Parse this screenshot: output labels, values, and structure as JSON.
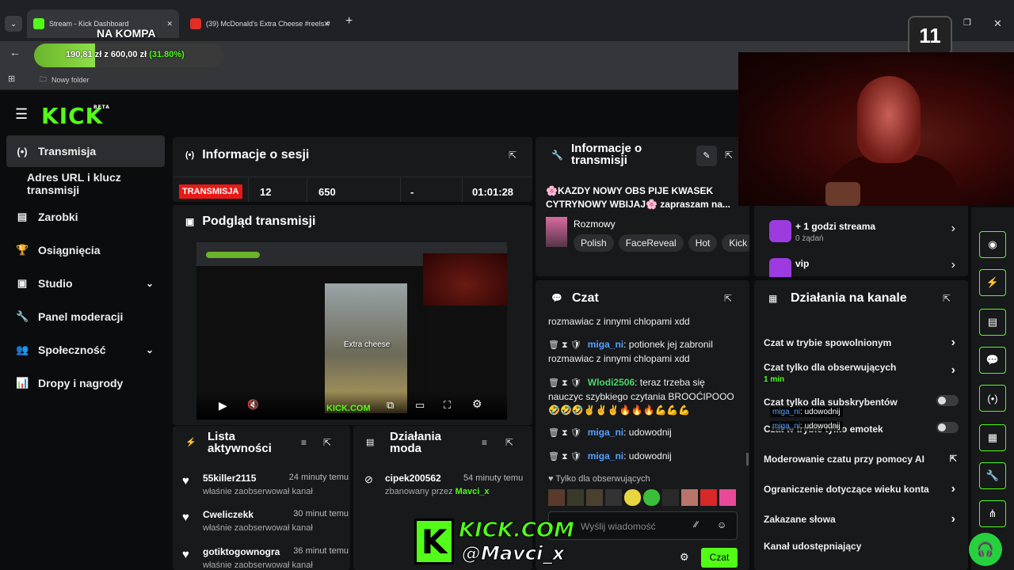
{
  "browser": {
    "tabs": [
      {
        "label": "Stream - Kick Dashboard",
        "active": true
      },
      {
        "label": "(39) McDonald's Extra Cheese #reels #"
      }
    ],
    "url_partial": "stream",
    "bookmark": "Nowy folder",
    "new_tab": "+",
    "window_controls": [
      "–",
      "❐",
      "✕"
    ]
  },
  "overlay": {
    "na_kompa": "NA KOMPA",
    "goal_text": "190,81 zł z 600,00 zł",
    "goal_percent": "(31.80%)",
    "goal_progress": 0.318,
    "counter": "11",
    "watermark_brand": "KICK.COM",
    "watermark_user": "@Mavci_x"
  },
  "kick": {
    "logo": "KICK",
    "beta": "BETA",
    "nav": [
      {
        "label": "Transmisja",
        "icon": "broadcast-icon",
        "glyph": "(•)",
        "selected": true
      },
      {
        "label": "Adres URL i klucz transmisji",
        "icon": "",
        "glyph": ""
      },
      {
        "label": "Zarobki",
        "icon": "earnings-icon",
        "glyph": "▤"
      },
      {
        "label": "Osiągnięcia",
        "icon": "trophy-icon",
        "glyph": "🏆"
      },
      {
        "label": "Studio",
        "icon": "studio-icon",
        "glyph": "▣",
        "chevron": true
      },
      {
        "label": "Panel moderacji",
        "icon": "wrench-icon",
        "glyph": "🔧"
      },
      {
        "label": "Społeczność",
        "icon": "community-icon",
        "glyph": "👥",
        "chevron": true
      },
      {
        "label": "Dropy i nagrody",
        "icon": "drops-icon",
        "glyph": "📊"
      }
    ],
    "session": {
      "title": "Informacje o sesji",
      "live": "TRANSMISJA",
      "viewers": "12",
      "followers": "650",
      "dash": "-",
      "time": "01:01:28"
    },
    "preview": {
      "title": "Podgląd transmisji",
      "caption": "Extra cheese",
      "watermark": "KICK.COM"
    },
    "stream_info": {
      "title": "Informacje o transmisji",
      "text": "🌸KAZDY NOWY OBS PIJE KWASEK CYTRYNOWY WBIJAJ🌸 zapraszam na...",
      "category": "Rozmowy",
      "tags": [
        "Polish",
        "FaceReveal",
        "Hot",
        "Kick"
      ]
    },
    "rewards": [
      {
        "label": "+ 1 godzi streama",
        "sub": "0 żądań"
      },
      {
        "label": "vip",
        "sub": ""
      }
    ],
    "activity": {
      "title": "Lista aktywności",
      "items": [
        {
          "name": "55killer2115",
          "time": "24 minuty temu",
          "sub": "właśnie zaobserwował kanał"
        },
        {
          "name": "Cweliczekk",
          "time": "30 minut temu",
          "sub": "właśnie zaobserwował kanał"
        },
        {
          "name": "gotiktogownogra",
          "time": "36 minut temu",
          "sub": "właśnie zaobserwował kanał"
        }
      ]
    },
    "mod_actions": {
      "title": "Działania moda",
      "items": [
        {
          "name": "cipek200562",
          "time": "54 minuty temu",
          "sub_prefix": "zbanowany przez",
          "sub_user": "Mavci_x"
        }
      ]
    },
    "chat": {
      "title": "Czat",
      "messages": [
        {
          "user": "",
          "text": "rozmawiac z innymi chlopami xdd"
        },
        {
          "user": "miga_ni",
          "text": ": potionek jej zabronil rozmawiac z innymi chlopami xdd"
        },
        {
          "user": "Wlodi2506",
          "text": ": teraz trzeba się nauczyc szybkiego czytania BROOĆIPOOO 🤣🤣🤣✌✌✌🔥🔥🔥💪💪💪"
        },
        {
          "user": "miga_ni",
          "text": ": udowodnij"
        },
        {
          "user": "miga_ni",
          "text": ": udowodnij"
        }
      ],
      "followers_only": "Tylko dla obserwujących",
      "placeholder": "Wyślij wiadomość",
      "send": "Czat"
    },
    "channel_actions": {
      "title": "Działania na kanale",
      "items": [
        {
          "label": "Czat w trybie spowolnionym",
          "type": "arrow"
        },
        {
          "label": "Czat tylko dla obserwujących",
          "sub": "1 min",
          "type": "arrow"
        },
        {
          "label": "Czat tylko dla subskrybentów",
          "type": "toggle"
        },
        {
          "label": "Czat w trybie tylko emotek",
          "type": "toggle"
        },
        {
          "label": "Moderowanie czatu przy pomocy AI",
          "type": "link"
        },
        {
          "label": "Ograniczenie dotyczące wieku konta",
          "type": "arrow"
        },
        {
          "label": "Zakazane słowa",
          "type": "arrow"
        },
        {
          "label": "Kanał udostępniający",
          "type": "none"
        }
      ],
      "overlay_msgs": [
        {
          "user": "miga_ni",
          "text": ": udowodnij"
        },
        {
          "user": "miga_ni",
          "text": ": udowodnij"
        }
      ]
    }
  }
}
